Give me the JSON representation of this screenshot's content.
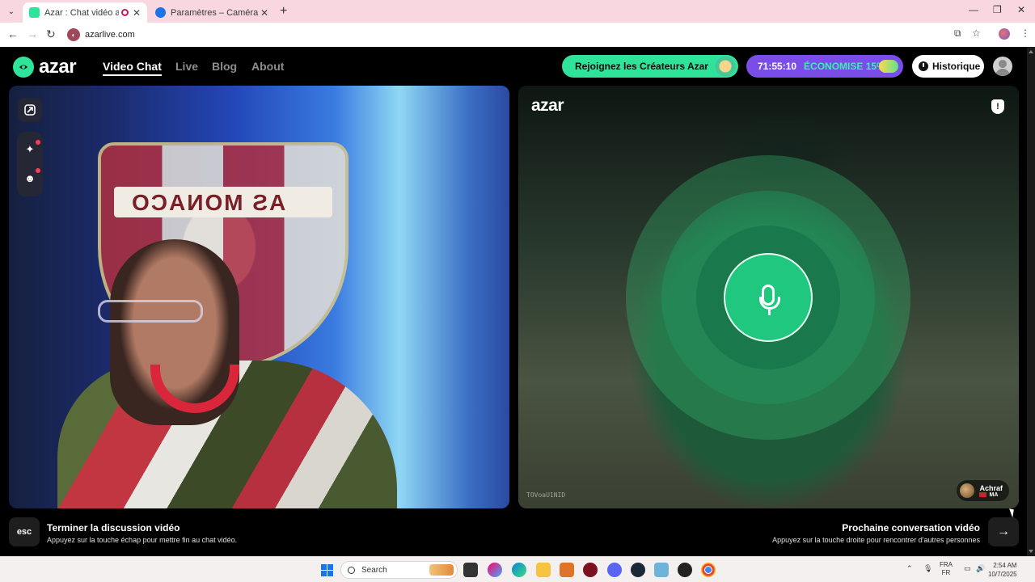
{
  "browser": {
    "tabs": [
      {
        "title": "Azar : Chat vidéo avec de n",
        "active": true
      },
      {
        "title": "Paramètres – Caméra",
        "active": false
      }
    ],
    "url": "azarlive.com"
  },
  "header": {
    "logo": "azar",
    "nav": [
      {
        "label": "Video Chat",
        "active": true
      },
      {
        "label": "Live",
        "active": false
      },
      {
        "label": "Blog",
        "active": false
      },
      {
        "label": "About",
        "active": false
      }
    ],
    "creators_button": "Rejoignez les Créateurs Azar",
    "promo": {
      "timer": "71:55:10",
      "discount": "ÉCONOMISE 15%"
    },
    "history_button": "Historique"
  },
  "local_video": {
    "crest_text": "AS MONACO"
  },
  "remote_video": {
    "watermark": "azar",
    "report_icon": "!",
    "user_id": "TOVoaU1NID",
    "peer": {
      "name": "Achraf",
      "country": "MA"
    }
  },
  "footer": {
    "esc_key": "esc",
    "end_title": "Terminer la discussion vidéo",
    "end_sub": "Appuyez sur la touche échap pour mettre fin au chat vidéo.",
    "next_title": "Prochaine conversation vidéo",
    "next_sub": "Appuyez sur la touche droite pour rencontrer d'autres personnes",
    "next_icon": "→"
  },
  "taskbar": {
    "search_placeholder": "Search",
    "lang_line1": "FRA",
    "lang_line2": "FR",
    "time": "2:54 AM",
    "date": "10/7/2025"
  },
  "colors": {
    "brand_green": "#2fe39b",
    "promo_purple": "#7a4de8",
    "tab_strip": "#f9d7e0"
  }
}
